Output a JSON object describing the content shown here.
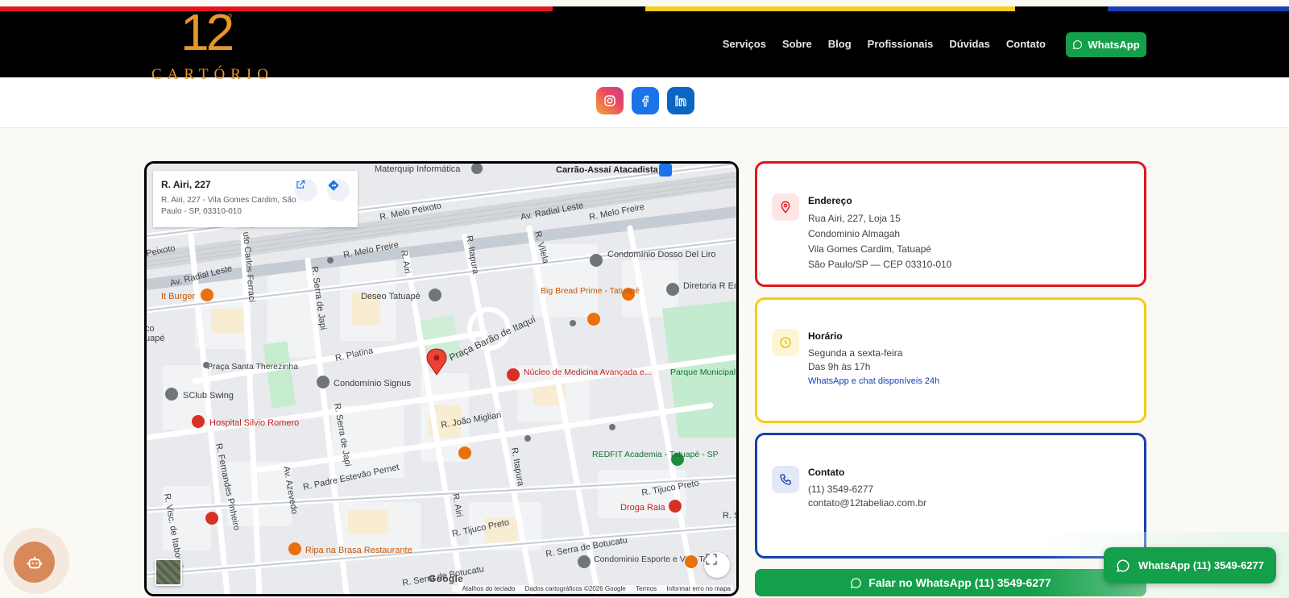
{
  "colors": {
    "red": "#e3141c",
    "yellow": "#f6cc14",
    "blue": "#1540b0",
    "green": "#14a04b",
    "logo": "#e8962a"
  },
  "header": {
    "logo": {
      "number": "12",
      "sup": "o",
      "word": "CARTÓRIO",
      "icon": "cartorio-logo"
    },
    "nav": [
      "Serviços",
      "Sobre",
      "Blog",
      "Profissionais",
      "Dúvidas",
      "Contato"
    ],
    "whatsapp_label": "WhatsApp"
  },
  "social": [
    {
      "name": "instagram-icon"
    },
    {
      "name": "facebook-icon"
    },
    {
      "name": "linkedin-icon"
    }
  ],
  "map": {
    "card": {
      "title": "R. Airi, 227",
      "address": "R. Airi, 227 - Vila Gomes Cardim, São Paulo - SP, 03310-010"
    },
    "streets": [
      "R. Melo Peixoto",
      "Av. Radial Leste",
      "R. Melo Freire",
      "Peixoto",
      "R. Airi",
      "R. Itapura",
      "R. Vilela",
      "uto Carlos Ferraci",
      "R. Serra de Japi",
      "R. Platina",
      "Praça Barão de Itaquí",
      "R. João Migliari",
      "R. Padre Estevão Pernet",
      "R. Fernandes Pinheiro",
      "R. Visc. de Itaboraí",
      "Av. Azevedo",
      "R. Tijuco Preto",
      "R. Serra de Botucatu",
      "R. Se",
      "R. Melo"
    ],
    "places": [
      "Materquip Informática",
      "Carrão-Assaí Atacadista",
      "Condomínio Dosso Del Liro",
      "Diretoria R Educação",
      "It Burger",
      "Big Bread Prime - Tatuapé",
      "Deseo Tatuapé",
      "Praça Santa Therezinha",
      "Condomínio Signus",
      "Núcleo de Medicina Avançada e...",
      "Parque Municipal do Tatuapé (Sampaio...",
      "SClub Swing",
      "Hospital Silvio Romero",
      "REDFIT Academia - Tatuapé - SP",
      "Droga Raia",
      "Ripa na Brasa Restaurante",
      "Condominio Esporte e Vida Tatuapé",
      "co",
      "uapé"
    ],
    "google": "Google",
    "credits": [
      "Atalhos do teclado",
      "Dados cartográficos ©2026 Google",
      "Termos",
      "Informar erro no mapa"
    ]
  },
  "cards": {
    "address": {
      "title": "Endereço",
      "lines": [
        "Rua Airi, 227, Loja 15",
        "Condominio Almagah",
        "Vila Gomes Cardim, Tatuapé",
        "São Paulo/SP — CEP 03310-010"
      ]
    },
    "hours": {
      "title": "Horário",
      "lines": [
        "Segunda a sexta-feira",
        "Das 9h às 17h"
      ],
      "note": "WhatsApp e chat disponíveis 24h"
    },
    "contact": {
      "title": "Contato",
      "lines": [
        "(11) 3549-6277",
        "contato@12tabeliao.com.br"
      ]
    }
  },
  "cta": {
    "label": "Falar no WhatsApp (11) 3549-6277"
  },
  "floating": {
    "label": "WhatsApp (11) 3549-6277"
  }
}
